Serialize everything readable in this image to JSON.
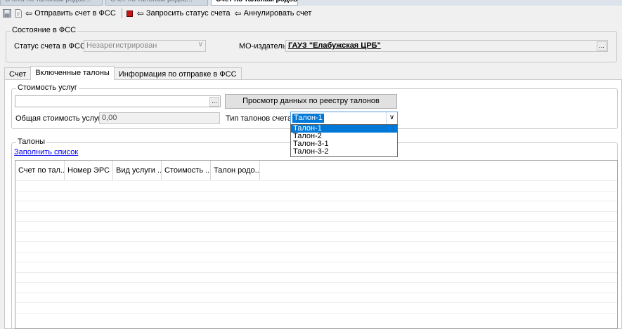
{
  "doc_tabs": [
    {
      "label": "Счета по талонам родов...",
      "active": false
    },
    {
      "label": "Счет по талонам родов...",
      "active": false
    },
    {
      "label": "Счет по талонам родов... X",
      "active": true
    }
  ],
  "toolbar": {
    "send_label": "Отправить счет в ФСС",
    "request_status_label": "Запросить статус счета",
    "cancel_label": "Аннулировать счет"
  },
  "fss_state": {
    "legend": "Состояние в ФСС",
    "status_label": "Статус счета в ФСС",
    "status_value": "Незарегистрирован",
    "issuer_label": "МО-издатель:",
    "issuer_value": "ГАУЗ \"Елабужская ЦРБ\""
  },
  "tabs": [
    {
      "label": "Счет",
      "active": false
    },
    {
      "label": "Включенные талоны",
      "active": true
    },
    {
      "label": "Информация по отправке в ФСС",
      "active": false
    }
  ],
  "services_cost": {
    "legend": "Стоимость услуг",
    "input_value": "",
    "view_button": "Просмотр данных по реестру талонов",
    "total_label": "Общая стоимость услуг:",
    "total_value": "0,00",
    "coupon_type_label": "Тип талонов счета:",
    "coupon_type_value": "Талон-1",
    "coupon_type_options": [
      "Талон-1",
      "Талон-2",
      "Талон-3-1",
      "Талон-3-2"
    ]
  },
  "coupons": {
    "legend": "Талоны",
    "fill_link": "Заполнить список",
    "columns": [
      "Счет по тал...",
      "Номер ЭРС",
      "Вид услуги ...",
      "Стоимость ...",
      "Талон родо..."
    ]
  },
  "ellipsis": "...",
  "colors": {
    "accent": "#0078d7",
    "link": "#0000ee"
  }
}
